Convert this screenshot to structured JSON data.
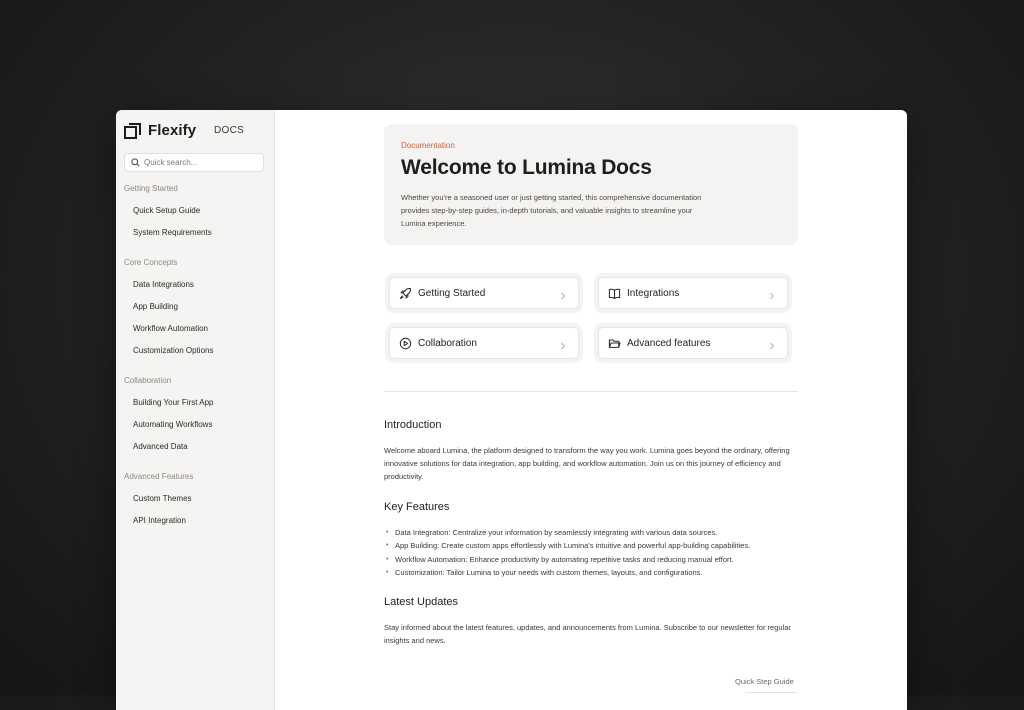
{
  "brand": {
    "name": "Flexify",
    "section": "DOCS"
  },
  "search": {
    "placeholder": "Quick search..."
  },
  "sidebar": {
    "groups": [
      {
        "title": "Getting Started",
        "items": [
          "Quick Setup Guide",
          "System Requirements"
        ]
      },
      {
        "title": "Core Concepts",
        "items": [
          "Data Integrations",
          "App Building",
          "Workflow Automation",
          "Customization Options"
        ]
      },
      {
        "title": "Collaboration",
        "items": [
          "Building Your First App",
          "Automating Workflows",
          "Advanced Data"
        ]
      },
      {
        "title": "Advanced Features",
        "items": [
          "Custom Themes",
          "API Integration"
        ]
      }
    ]
  },
  "hero": {
    "eyebrow": "Documentation",
    "title": "Welcome to Lumina Docs",
    "description": "Whether you're a seasoned user or just getting started, this comprehensive documentation provides step-by-step guides, in-depth tutorials, and valuable insights to streamline your Lumina experience."
  },
  "cards": [
    {
      "label": "Getting Started",
      "icon": "rocket-icon"
    },
    {
      "label": "Integrations",
      "icon": "book-icon"
    },
    {
      "label": "Collaboration",
      "icon": "play-circle-icon"
    },
    {
      "label": "Advanced features",
      "icon": "folder-icon"
    }
  ],
  "intro": {
    "heading": "Introduction",
    "text": "Welcome aboard Lumina, the platform designed to transform the way you work. Lumina goes beyond the ordinary, offering innovative solutions for data integration, app building, and workflow automation. Join us on this journey of efficiency and productivity."
  },
  "features": {
    "heading": "Key Features",
    "items": [
      "Data Integration: Centralize your information by seamlessly integrating with various data sources.",
      "App Building: Create custom apps effortlessly with Lumina's intuitive and powerful app-building capabilities.",
      "Workflow Automation: Enhance productivity by automating repetitive tasks and reducing manual effort.",
      "Customization: Tailor Lumina to your needs with custom themes, layouts, and configurations."
    ]
  },
  "updates": {
    "heading": "Latest Updates",
    "text": "Stay informed about the latest features, updates, and announcements from Lumina. Subscribe to our newsletter for regular insights and news."
  },
  "footer": {
    "next_link": "Quick Step Guide"
  },
  "colors": {
    "accent": "#d9612e",
    "sidebar_bg": "#f5f4f2",
    "hero_bg": "#f4f3f1"
  }
}
